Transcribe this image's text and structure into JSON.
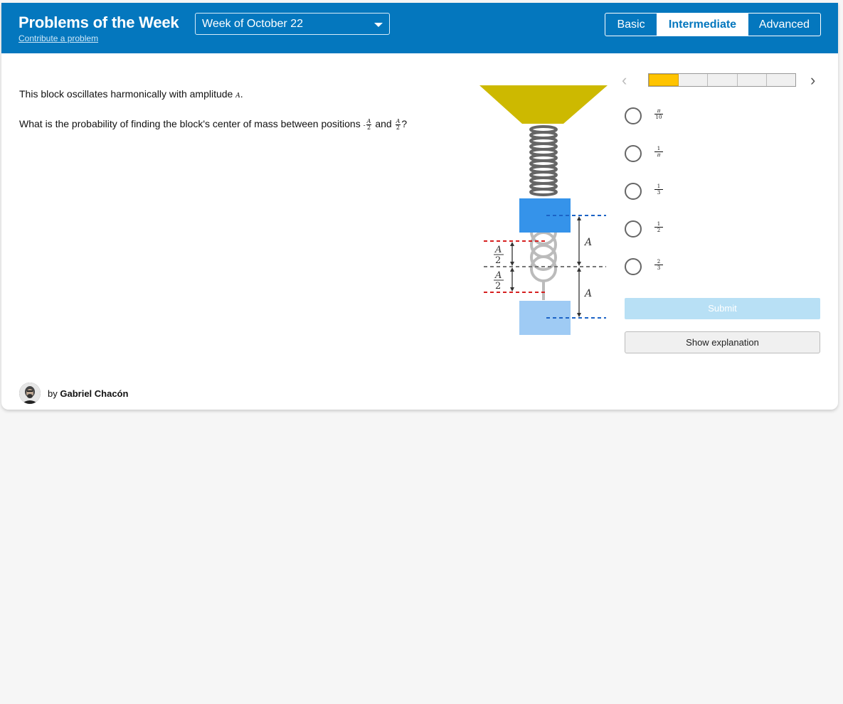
{
  "header": {
    "title": "Problems of the Week",
    "contribute_link": "Contribute a problem",
    "week_select": "Week of October 22",
    "levels": [
      "Basic",
      "Intermediate",
      "Advanced"
    ],
    "selected_level": "Intermediate",
    "accent_color": "#0477be"
  },
  "question": {
    "line1_prefix": "This block oscillates harmonically with amplitude",
    "line1_var": "A",
    "line1_suffix": ".",
    "line2_prefix": "What is the probability of finding the block's center of mass between positions",
    "neg_sign": "-",
    "frac_num": "A",
    "frac_den": "2",
    "connector": "and",
    "line2_suffix": "?"
  },
  "figure": {
    "label_A_upper": "A",
    "label_A_lower": "A",
    "half_num_top": "A",
    "half_den_top": "2",
    "half_num_bottom": "A",
    "half_den_bottom": "2"
  },
  "progress": {
    "segments": 5,
    "current": 1,
    "active_color": "#ffc400"
  },
  "nav": {
    "prev_icon": "chevron-left-icon",
    "next_icon": "chevron-right-icon",
    "prev_glyph": "‹",
    "next_glyph": "›"
  },
  "choices": [
    {
      "num": "π",
      "den": "10"
    },
    {
      "num": "1",
      "den": "π"
    },
    {
      "num": "1",
      "den": "3"
    },
    {
      "num": "1",
      "den": "2"
    },
    {
      "num": "2",
      "den": "3"
    }
  ],
  "buttons": {
    "submit": "Submit",
    "explanation": "Show explanation"
  },
  "author": {
    "by": "by",
    "name": "Gabriel Chacón"
  }
}
